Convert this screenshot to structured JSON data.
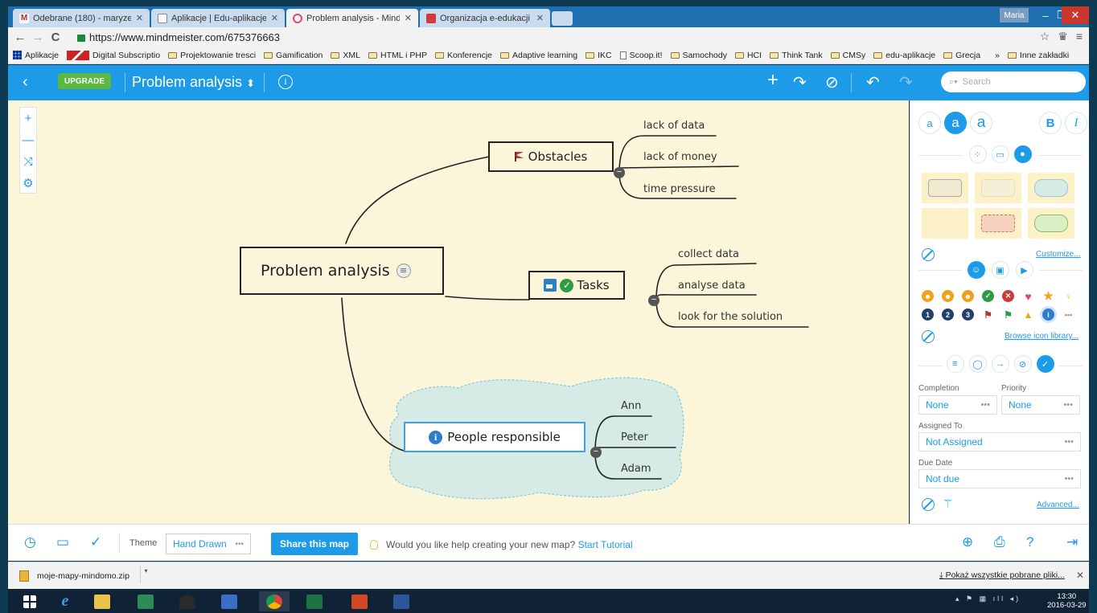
{
  "browser": {
    "tabs": [
      {
        "label": "Odebrane (180) - maryze",
        "favicon_color": "#c5221f",
        "favicon_glyph": "M"
      },
      {
        "label": "Aplikacje | Edu-aplikacje",
        "favicon_color": "#ffffff"
      },
      {
        "label": "Problem analysis - MindM",
        "favicon_color": "#e04a7b"
      },
      {
        "label": "Organizacja e-edukacji",
        "favicon_color": "#d23a3a"
      }
    ],
    "window_user": "Maria",
    "url": "https://www.mindmeister.com/675376663",
    "bookmarks": [
      {
        "label": "Aplikacje",
        "icon": "apps-grid-icon"
      },
      {
        "label": "Digital Subscriptio",
        "icon": "red-logo-icon"
      },
      {
        "label": "Projektowanie tresci",
        "icon": "folder-icon"
      },
      {
        "label": "Gamification",
        "icon": "folder-icon"
      },
      {
        "label": "XML",
        "icon": "folder-icon"
      },
      {
        "label": "HTML i PHP",
        "icon": "folder-icon"
      },
      {
        "label": "Konferencje",
        "icon": "folder-icon"
      },
      {
        "label": "Adaptive learning",
        "icon": "folder-icon"
      },
      {
        "label": "IKC",
        "icon": "folder-icon"
      },
      {
        "label": "Scoop.it!",
        "icon": "page-icon"
      },
      {
        "label": "Samochody",
        "icon": "folder-icon"
      },
      {
        "label": "HCI",
        "icon": "folder-icon"
      },
      {
        "label": "Think Tank",
        "icon": "folder-icon"
      },
      {
        "label": "CMSy",
        "icon": "folder-icon"
      },
      {
        "label": "edu-aplikacje",
        "icon": "folder-icon"
      },
      {
        "label": "Grecja",
        "icon": "folder-icon"
      }
    ],
    "bookmarks_more": "»",
    "other_bookmarks": "Inne zakładki"
  },
  "app": {
    "upgrade_label": "UPGRADE",
    "map_title": "Problem analysis",
    "search_placeholder": "Search",
    "brand_color": "#1d9be8"
  },
  "mindmap": {
    "root": "Problem analysis",
    "branches": {
      "obstacles": {
        "label": "Obstacles",
        "icon": "flag-icon",
        "children": [
          "lack of data",
          "lack of money",
          "time pressure"
        ]
      },
      "tasks": {
        "label": "Tasks",
        "icon": "task-check-icon",
        "children": [
          "collect data",
          "analyse data",
          "look for the solution"
        ]
      },
      "people": {
        "label": "People responsible",
        "icon": "info-icon",
        "children": [
          "Ann",
          "Peter",
          "Adam"
        ]
      }
    },
    "canvas_color": "#fbf5d9",
    "cloud_color": "#d6ebe6"
  },
  "panel": {
    "links": {
      "customize": "Customize...",
      "browse_icons": "Browse icon library...",
      "advanced": "Advanced..."
    },
    "completion_label": "Completion",
    "completion_value": "None",
    "priority_label": "Priority",
    "priority_value": "None",
    "assigned_label": "Assigned To",
    "assigned_value": "Not Assigned",
    "due_label": "Due Date",
    "due_value": "Not due",
    "text_style_buttons": [
      "a",
      "a",
      "a",
      "B",
      "I"
    ]
  },
  "bottom": {
    "theme_label": "Theme",
    "theme_value": "Hand Drawn",
    "share_label": "Share this map",
    "tip_text": "Would you like help creating your new map?",
    "tip_link": "Start Tutorial"
  },
  "downloads": {
    "file": "moje-mapy-mindomo.zip",
    "show_all": "Pokaż wszystkie pobrane pliki..."
  },
  "taskbar": {
    "time": "13:30",
    "date": "2016-03-29"
  }
}
